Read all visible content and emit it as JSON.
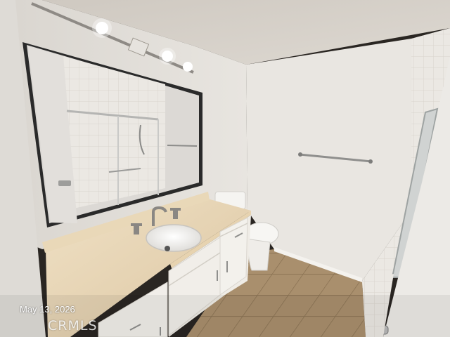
{
  "photo": {
    "date_stamp": "May 13, 2026",
    "watermark": "CRMLS"
  },
  "colors": {
    "wall": "#e7e4df",
    "ceiling": "#d6d1ca",
    "countertop": "#e4d2b2",
    "cabinet": "#efece6",
    "floor_tile": "#a88e6c",
    "mirror_frame": "#1c1c1c"
  }
}
